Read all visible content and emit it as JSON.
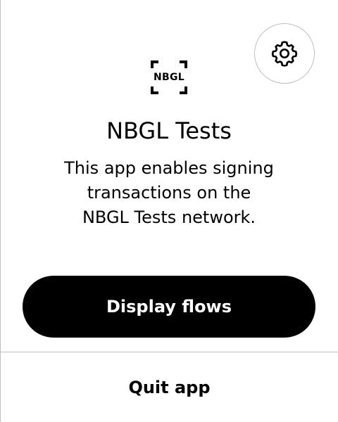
{
  "app": {
    "logo_text": "NBGL",
    "title": "NBGL Tests",
    "description_lines": [
      "This app enables signing",
      "transactions on the",
      "NBGL Tests network."
    ]
  },
  "settings": {
    "icon": "gear-icon"
  },
  "actions": {
    "primary_label": "Display flows",
    "quit_label": "Quit app"
  },
  "colors": {
    "primary_button_bg": "#000000",
    "primary_button_text": "#ffffff",
    "divider": "#bfbfbf",
    "background": "#ffffff"
  }
}
